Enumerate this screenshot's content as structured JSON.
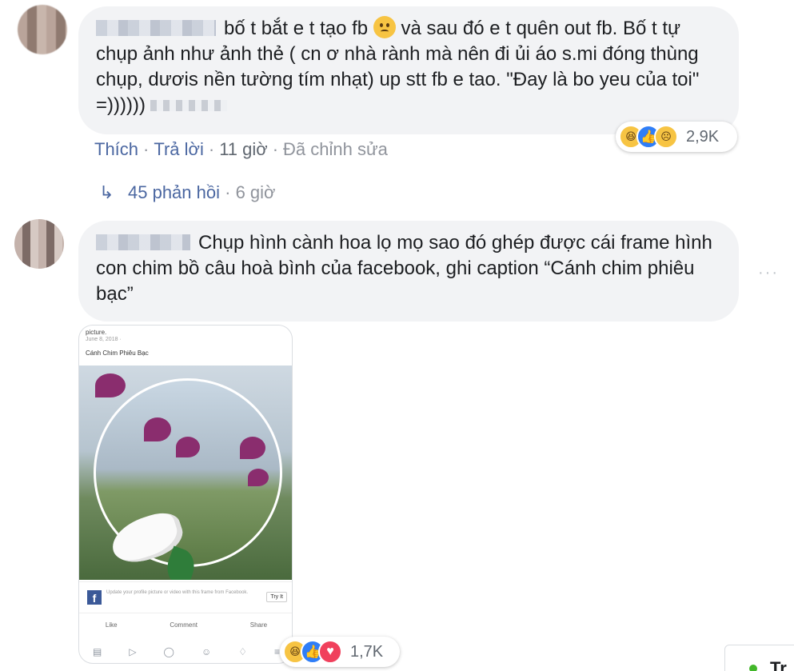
{
  "comment1": {
    "text": "bố t bắt e t tạo fb",
    "text_after_emoji": "và sau đó e t quên out fb. Bố t tự chụp ảnh như ảnh thẻ ( cn ơ nhà rành mà nên đi ủi áo s.mi đóng thùng chụp, dươis nền tường tím nhạt) up stt fb e tao. \"Đay là bo yeu của toi\" =))))))",
    "emoji": "confused-face",
    "actions": {
      "like": "Thích",
      "reply": "Trả lời",
      "time": "11 giờ",
      "edited": "Đã chỉnh sửa"
    },
    "reactions": {
      "icons": [
        "haha",
        "like",
        "sad"
      ],
      "count": "2,9K"
    },
    "replies": {
      "label": "45 phản hồi",
      "time": "6 giờ"
    }
  },
  "comment2": {
    "text": "Chụp hình cành hoa lọ mọ sao đó ghép được cái frame hình con chim bồ câu hoà bình của facebook, ghi caption “Cánh chim phiêu bạc”",
    "more": "···",
    "reactions": {
      "icons": [
        "haha",
        "like",
        "love"
      ],
      "count": "1,7K"
    },
    "attachment": {
      "poster": "picture.",
      "date": "June 8, 2018 ·",
      "caption": "Cánh Chim Phiêu Bạc",
      "frame_text": "Update your profile picture or video with this frame from Facebook.",
      "frame_button": "Try It",
      "actions": [
        "Like",
        "Comment",
        "Share"
      ]
    }
  },
  "chat_tray": {
    "label": "Tr"
  },
  "colors": {
    "link": "#4b67a1",
    "bubble": "#f2f3f5",
    "muted": "#90949c",
    "online": "#42b72a"
  }
}
